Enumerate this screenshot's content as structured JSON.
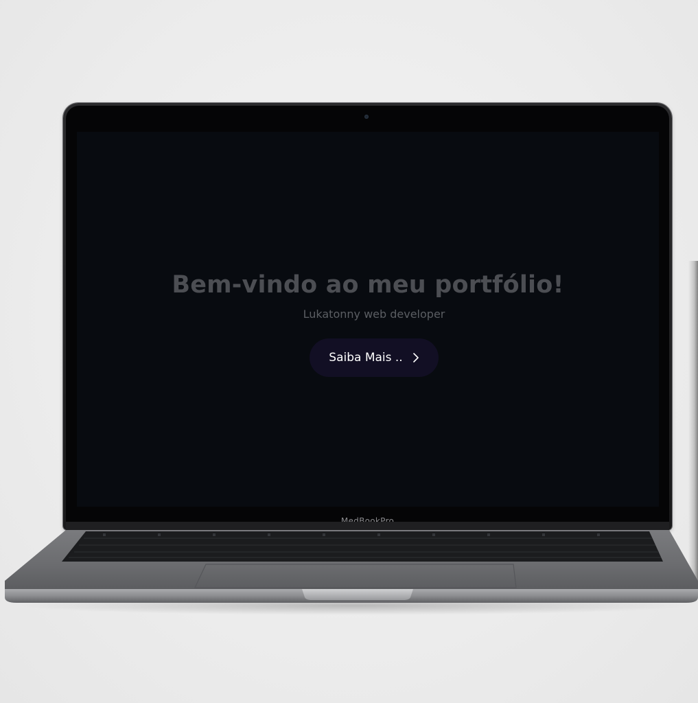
{
  "hero": {
    "title": "Bem-vindo ao meu portfólio!",
    "subtitle": "Lukatonny web developer",
    "cta_label": "Saiba Mais ..",
    "cta_icon": "chevron-right-icon"
  },
  "device": {
    "label": "MedBookPro"
  },
  "colors": {
    "screen_bg": "#080b10",
    "title": "#4c4e53",
    "subtitle": "#5b5e63",
    "cta_bg": "#120f24",
    "cta_text": "#ffffff",
    "chassis": "#6f7073"
  }
}
